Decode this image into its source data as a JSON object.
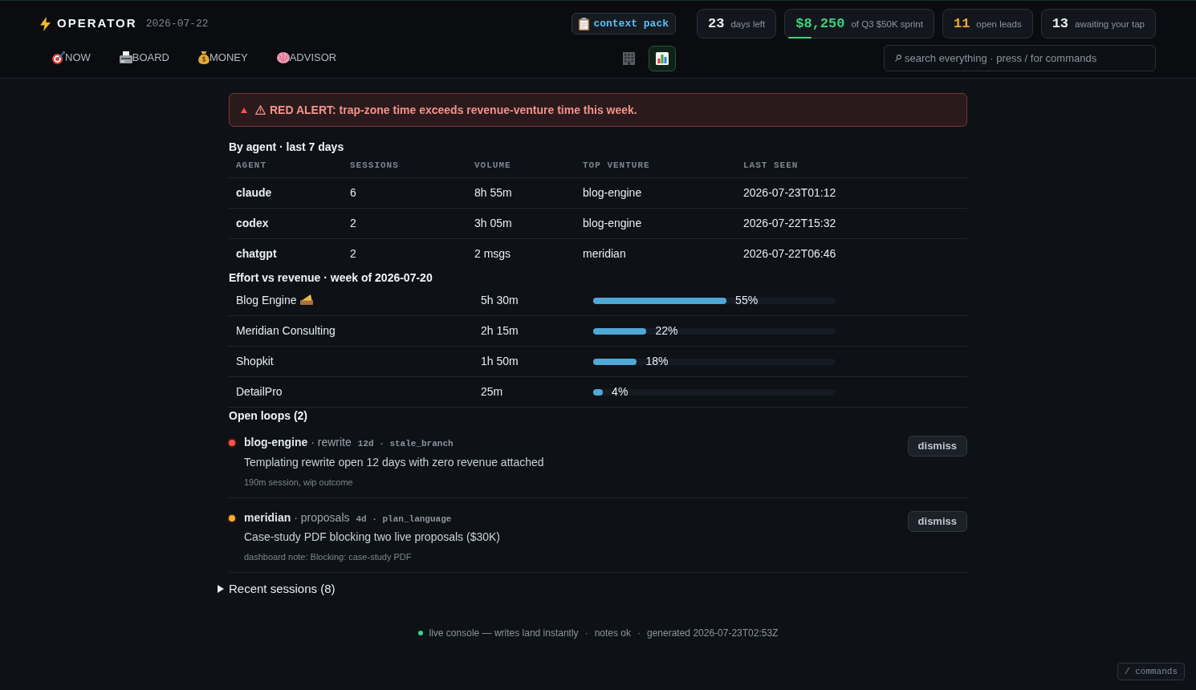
{
  "header": {
    "brand": "OPERATOR",
    "date": "2026-07-22",
    "nav": [
      {
        "label": "NOW",
        "selected": false
      },
      {
        "label": "BOARD",
        "selected": false
      },
      {
        "label": "MONEY",
        "selected": false
      },
      {
        "label": "ADVISOR",
        "selected": false
      }
    ],
    "context_button": {
      "label": "context pack"
    },
    "stats": [
      {
        "value": "23",
        "label": "days left",
        "color": "#e6edf3"
      },
      {
        "value": "$8,250",
        "label": "of Q3 $50K sprint",
        "color": "#3fd17f",
        "level": 0.165
      },
      {
        "value": "11",
        "label": "open leads",
        "color": "#f0a830"
      },
      {
        "value": "13",
        "label": "awaiting your tap",
        "color": "#e6edf3"
      }
    ],
    "view_toggle": [
      {
        "selected": false
      },
      {
        "selected": true
      }
    ],
    "search": {
      "placeholder": "search everything · press / for commands"
    }
  },
  "alert": {
    "text": "RED ALERT: trap-zone time exceeds revenue-venture time this week."
  },
  "agents": {
    "title": "By agent · last 7 days",
    "columns": [
      "AGENT",
      "SESSIONS",
      "VOLUME",
      "TOP VENTURE",
      "LAST SEEN"
    ],
    "rows": [
      [
        "claude",
        "6",
        "8h 55m",
        "blog-engine",
        "2026-07-23T01:12"
      ],
      [
        "codex",
        "2",
        "3h 05m",
        "blog-engine",
        "2026-07-22T15:32"
      ],
      [
        "chatgpt",
        "2",
        "2 msgs",
        "meridian",
        "2026-07-22T06:46"
      ]
    ]
  },
  "effort": {
    "title": "Effort vs revenue · week of 2026-07-20",
    "rows": [
      {
        "name": "Blog Engine",
        "trap_zone": true,
        "time": "5h 30m",
        "level": 0.55,
        "share": "55%"
      },
      {
        "name": "Meridian Consulting",
        "trap_zone": false,
        "time": "2h 15m",
        "level": 0.22,
        "share": "22%"
      },
      {
        "name": "Shopkit",
        "trap_zone": false,
        "time": "1h 50m",
        "level": 0.18,
        "share": "18%"
      },
      {
        "name": "DetailPro",
        "trap_zone": false,
        "time": "25m",
        "level": 0.04,
        "share": "4%"
      }
    ]
  },
  "open_loops": {
    "title": "Open loops (2)",
    "items": [
      {
        "color": "#f85149",
        "heading": "**blog-engine** · rewrite",
        "meta": "12d · stale_branch",
        "text": "Templating rewrite open 12 days with zero revenue attached",
        "note": "190m session, wip outcome",
        "action": "dismiss"
      },
      {
        "color": "#f0b429",
        "heading": "**meridian** · proposals",
        "meta": "4d · plan_language",
        "text": "Case-study PDF blocking two live proposals ($30K)",
        "note": "dashboard note: Blocking: case-study PDF",
        "action": "dismiss"
      }
    ]
  },
  "recent_sessions": {
    "label": "Recent sessions (8)",
    "expanded": false
  },
  "footer": {
    "live": true,
    "items": [
      "live console — writes land instantly",
      "·",
      "notes ok",
      "·",
      "generated 2026-07-23T02:53Z"
    ]
  },
  "command_hint": "/ commands"
}
